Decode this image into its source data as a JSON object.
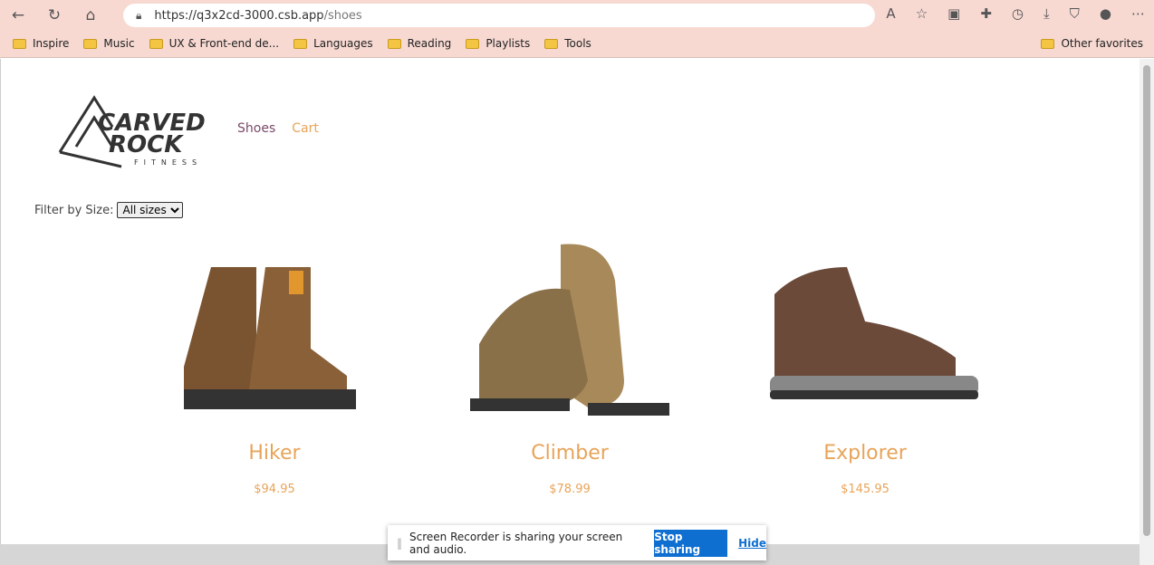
{
  "browser": {
    "url_host": "https://q3x2cd-3000.csb.app",
    "url_path": "/shoes",
    "bookmarks": [
      "Inspire",
      "Music",
      "UX & Front-end de...",
      "Languages",
      "Reading",
      "Playlists",
      "Tools"
    ],
    "other_favorites": "Other favorites"
  },
  "site": {
    "logo_text": "CARVED ROCK FITNESS",
    "nav": {
      "shoes": "Shoes",
      "cart": "Cart"
    },
    "nav_colors": {
      "active": "#7a4a6a",
      "link": "#e8a45a"
    },
    "filter": {
      "label": "Filter by Size:",
      "selected": "All sizes"
    },
    "products": [
      {
        "name": "Hiker",
        "price": "$94.95"
      },
      {
        "name": "Climber",
        "price": "$78.99"
      },
      {
        "name": "Explorer",
        "price": "$145.95"
      }
    ]
  },
  "recorder": {
    "message": "Screen Recorder is sharing your screen and audio.",
    "stop": "Stop sharing",
    "hide": "Hide"
  }
}
